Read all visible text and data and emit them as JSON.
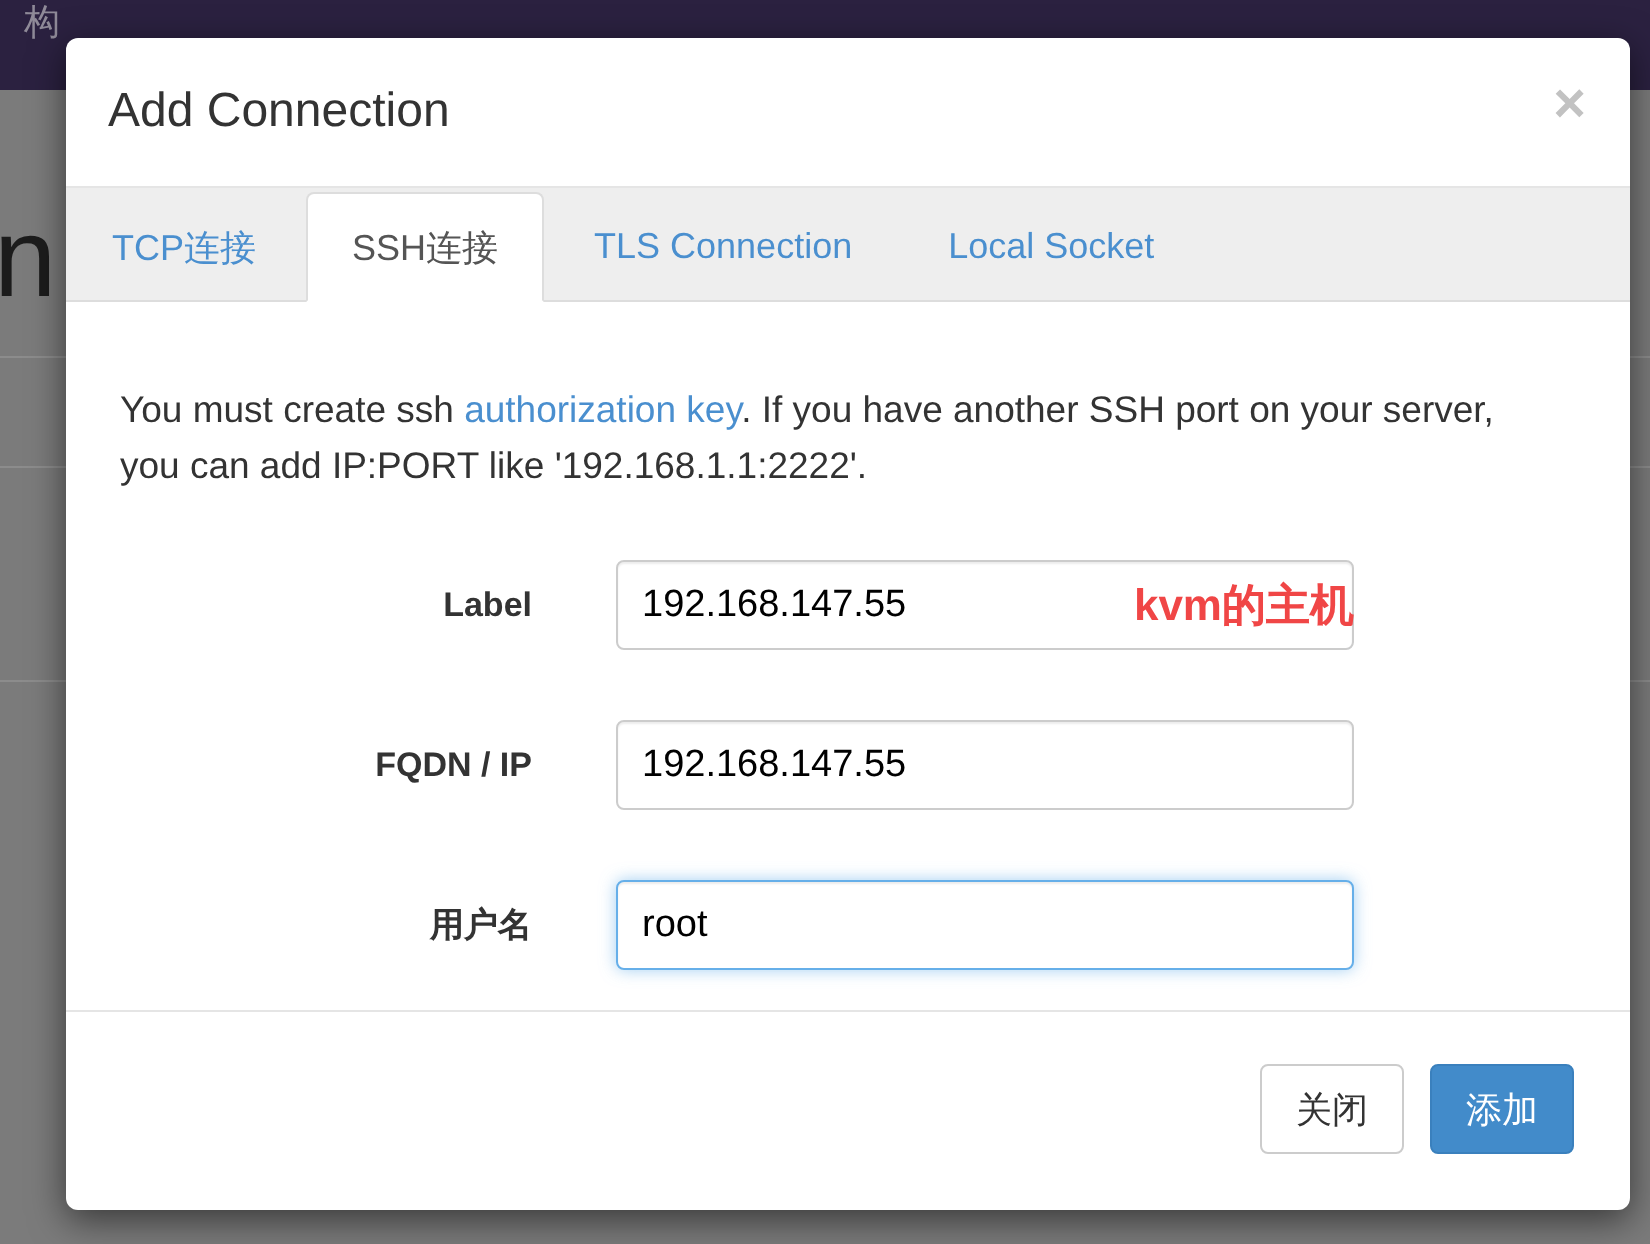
{
  "background": {
    "navbar_text": "构",
    "page_heading": "n"
  },
  "dialog": {
    "title": "Add Connection",
    "close": "×",
    "tabs": [
      {
        "label": "TCP连接",
        "selected": false
      },
      {
        "label": "SSH连接",
        "selected": true
      },
      {
        "label": "TLS Connection",
        "selected": false
      },
      {
        "label": "Local Socket",
        "selected": false
      }
    ],
    "notice": {
      "before": "You must create ssh ",
      "link": "authorization key",
      "after": ". If you have another SSH port on your server, you can add IP:PORT like '192.168.1.1:2222'."
    },
    "fields": [
      {
        "label": "Label",
        "value": "192.168.147.55",
        "annotation": "kvm的主机",
        "focused": false
      },
      {
        "label": "FQDN / IP",
        "value": "192.168.147.55",
        "focused": false
      },
      {
        "label": "用户名",
        "value": "root",
        "focused": true
      }
    ],
    "buttons": [
      {
        "label": "关闭",
        "kind": "default"
      },
      {
        "label": "添加",
        "kind": "primary"
      }
    ]
  }
}
